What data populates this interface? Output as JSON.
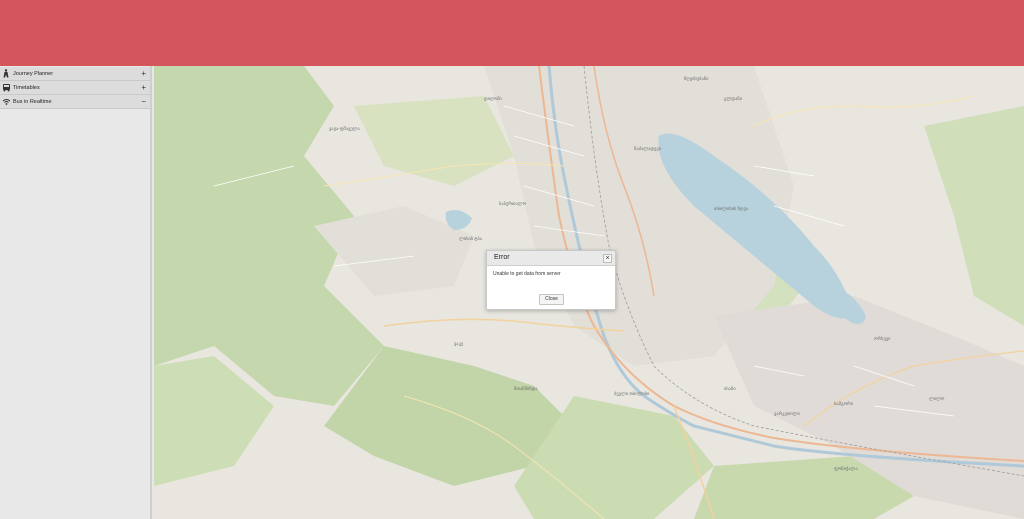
{
  "header": {
    "color": "#d5555d"
  },
  "sidebar": {
    "items": [
      {
        "label": "Journey Planner",
        "toggle": "+",
        "icon": "pedestrian-icon"
      },
      {
        "label": "Timetables",
        "toggle": "+",
        "icon": "bus-icon"
      },
      {
        "label": "Bus in Realtime",
        "toggle": "−",
        "icon": "signal-icon"
      }
    ]
  },
  "map": {
    "labels": [
      "ზღვისუბანი",
      "ვაჟა-ფშაველა",
      "დიღომი",
      "ლისის ტბა",
      "საბურთალო",
      "ვაკე",
      "მთაწმინდა",
      "ნაძალადევი",
      "გლდანი",
      "ისანი",
      "სამგორი",
      "ორხევი",
      "ვარკეთილი",
      "ძველი თბილისი",
      "ფონიჭალა",
      "ლილო",
      "თბილისის ზღვა"
    ]
  },
  "dialog": {
    "title": "Error",
    "message": "Unable to get data from server",
    "close_label": "Close",
    "close_x": "×"
  }
}
